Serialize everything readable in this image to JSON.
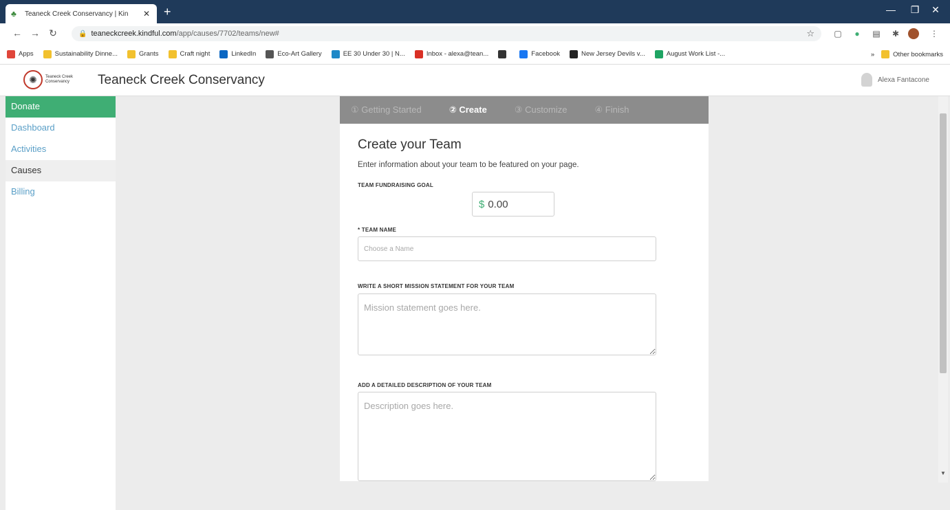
{
  "browser": {
    "tab_title": "Teaneck Creek Conservancy | Kin",
    "new_tab": "+",
    "close": "✕",
    "url_host": "teaneckcreek.kindful.com",
    "url_path": "/app/causes/7702/teams/new#",
    "bookmarks": [
      {
        "label": "Apps",
        "color": "#e0463a"
      },
      {
        "label": "Sustainability Dinne...",
        "color": "#f2c12e"
      },
      {
        "label": "Grants",
        "color": "#f2c12e"
      },
      {
        "label": "Craft night",
        "color": "#f2c12e"
      },
      {
        "label": "LinkedIn",
        "color": "#0a66c2"
      },
      {
        "label": "Eco-Art Gallery",
        "color": "#555555"
      },
      {
        "label": "EE 30 Under 30 | N...",
        "color": "#1e88c7"
      },
      {
        "label": "Inbox - alexa@tean...",
        "color": "#d93025"
      },
      {
        "label": "",
        "color": "#333333"
      },
      {
        "label": "Facebook",
        "color": "#1877f2"
      },
      {
        "label": "New Jersey Devils v...",
        "color": "#222222"
      },
      {
        "label": "August Work List -...",
        "color": "#1fa463"
      }
    ],
    "other_bookmarks": "Other bookmarks"
  },
  "header": {
    "logo_line1": "Teaneck Creek",
    "logo_line2": "Conservancy",
    "org_name": "Teaneck Creek Conservancy",
    "user_name": "Alexa Fantacone"
  },
  "sidebar": {
    "items": [
      "Donate",
      "Dashboard",
      "Activities",
      "Causes",
      "Billing"
    ]
  },
  "steps": [
    "① Getting Started",
    "② Create",
    "③ Customize",
    "④ Finish"
  ],
  "form": {
    "title": "Create your Team",
    "intro": "Enter information about your team to be featured on your page.",
    "goal_label": "Team Fundraising Goal",
    "goal_currency": "$",
    "goal_value": "0.00",
    "name_label": "* Team Name",
    "name_placeholder": "Choose a Name",
    "mission_label": "Write a short mission statement for your team",
    "mission_placeholder": "Mission statement goes here.",
    "desc_label": "Add a detailed description of your team",
    "desc_placeholder": "Description goes here."
  },
  "colors": {
    "titlebar": "#1f3a5a",
    "donate_green": "#3fae74",
    "link_blue": "#5a9fc7",
    "step_bar": "#8c8c8c"
  }
}
